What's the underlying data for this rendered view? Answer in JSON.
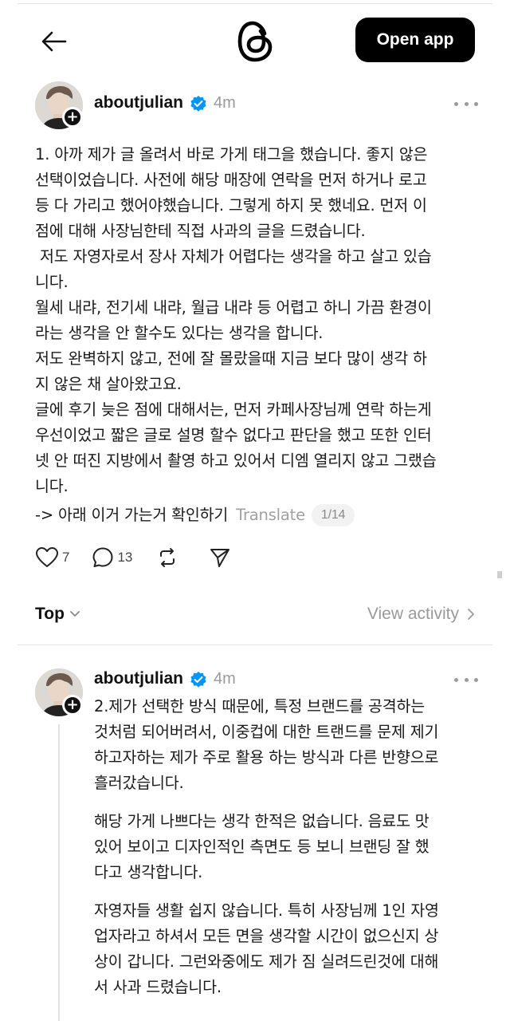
{
  "header": {
    "back_icon": "arrow-left-icon",
    "logo_icon": "threads-logo",
    "open_app_label": "Open app"
  },
  "post": {
    "username": "aboutjulian",
    "verified": true,
    "time": "4m",
    "body": "1. 아까 제가 글 올려서 바로 가게 태그을 했습니다. 좋지 않은\n선택이었습니다. 사전에 해당 매장에 연락을 먼저 하거나 로고\n등 다 가리고 했어야했습니다. 그렇게 하지 못 했네요. 먼저 이\n점에 대해 사장님한테 직접 사과의 글을 드렸습니다.\n 저도 자영자로서 장사 자체가 어렵다는 생각을 하고 살고 있습\n니다.\n월세 내랴, 전기세 내랴, 월급 내랴 등 어렵고 하니 가끔 환경이\n라는 생각을 안 할수도 있다는 생각을 합니다.\n저도 완벽하지 않고, 전에 잘 몰랐을때 지금 보다 많이 생각 하\n지 않은 채 살아왔고요.\n글에 후기 늦은 점에 대해서는, 먼저 카페사장님께 연락 하는게\n우선이었고 짧은 글로 설명 할수 없다고 판단을 했고 또한 인터\n넷 안 떠진 지방에서 촬영 하고 있어서 디엠 열리지 않고 그랬습\n니다.",
    "last_line": "-> 아래 이거 가는거 확인하기",
    "translate_label": "Translate",
    "page_indicator": "1/14",
    "likes": "7",
    "replies": "13"
  },
  "sort_bar": {
    "sort_label": "Top",
    "view_activity_label": "View activity"
  },
  "reply": {
    "username": "aboutjulian",
    "verified": true,
    "time": "4m",
    "paragraphs": [
      "2.제가 선택한 방식 때문에, 특정 브랜드를 공격하는\n것처럼 되어버려서, 이중컵에 대한 트랜드를 문제 제기\n하고자하는 제가 주로 활용 하는 방식과 다른 반향으로\n흘러갔습니다.",
      "해당 가게 나쁘다는 생각 한적은 없습니다. 음료도 맛\n있어 보이고 디자인적인 측면도 등 보니 브랜딩 잘 했\n다고 생각합니다.",
      "자영자들 생활 쉽지 않습니다. 특히 사장님께 1인 자영\n업자라고 하셔서 모든 면을 생각할 시간이 없으신지 상\n상이 갑니다. 그런와중에도 제가 짐 실려드린것에 대해\n서 사과 드렸습니다."
    ]
  },
  "colors": {
    "accent_verified": "#0095f6",
    "button_bg": "#000000",
    "muted_text": "#9a9a9a"
  }
}
